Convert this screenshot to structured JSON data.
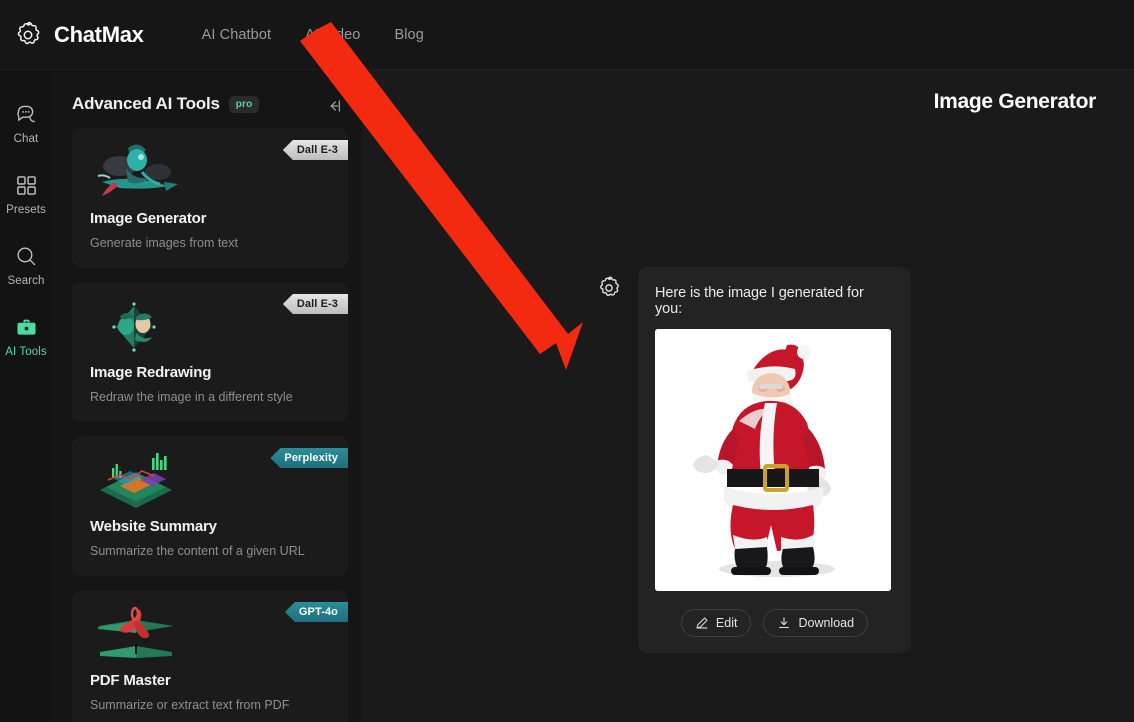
{
  "header": {
    "brand": "ChatMax",
    "logo_icon": "gear-logo-icon",
    "nav": [
      {
        "label": "AI Chatbot"
      },
      {
        "label": "AI Video"
      },
      {
        "label": "Blog"
      }
    ]
  },
  "sidebar": {
    "items": [
      {
        "label": "Chat",
        "icon": "chat-bubbles-icon",
        "active": false
      },
      {
        "label": "Presets",
        "icon": "grid-squares-icon",
        "active": false
      },
      {
        "label": "Search",
        "icon": "magnifier-icon",
        "active": false
      },
      {
        "label": "AI Tools",
        "icon": "toolbox-icon",
        "active": true
      }
    ],
    "active_color": "#4ddba0"
  },
  "tools_panel": {
    "title": "Advanced AI Tools",
    "pro_badge": "pro",
    "collapse_icon": "collapse-left-icon",
    "cards": [
      {
        "title": "Image Generator",
        "description": "Generate images from text",
        "badge": "Dall E-3",
        "badge_style": "silver",
        "art": "witch-on-broomstick-art"
      },
      {
        "title": "Image Redrawing",
        "description": "Redraw the image in a different style",
        "badge": "Dall E-3",
        "badge_style": "silver",
        "art": "diamond-portrait-art"
      },
      {
        "title": "Website Summary",
        "description": "Summarize the content of a given URL",
        "badge": "Perplexity",
        "badge_style": "teal",
        "art": "isometric-dashboard-art"
      },
      {
        "title": "PDF Master",
        "description": "Summarize or extract text from PDF",
        "badge": "GPT-4o",
        "badge_style": "teal",
        "art": "pdf-acrobat-art"
      }
    ]
  },
  "main": {
    "title": "Image Generator",
    "message": {
      "avatar_icon": "gear-avatar-icon",
      "text": "Here is the image I generated for you:",
      "image_alt": "santa-claus-standing-photo"
    },
    "actions": [
      {
        "label": "Edit",
        "icon": "pencil-icon"
      },
      {
        "label": "Download",
        "icon": "download-icon"
      }
    ]
  },
  "annotation": {
    "arrow_color": "#f42a10",
    "points_to": "AI Video"
  },
  "colors": {
    "page_bg": "#151515",
    "panel_bg": "#1a1a1a",
    "card_bg": "#1b1b1b",
    "accent_green": "#4ddba0",
    "teal_badge": "#1e6f7c"
  }
}
